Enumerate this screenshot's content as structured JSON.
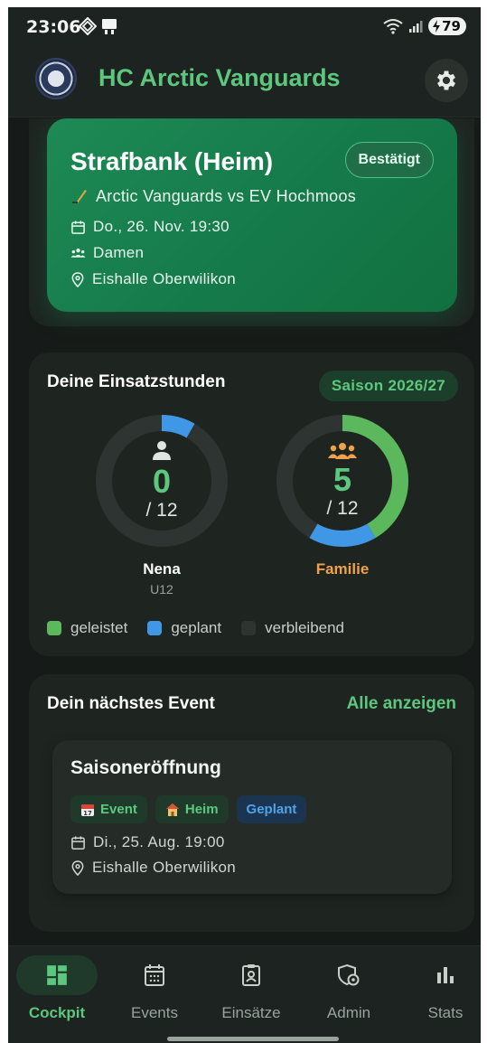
{
  "status_bar": {
    "time": "23:06",
    "battery": "79",
    "icons": [
      "nfc-icon",
      "cast-icon",
      "wifi-icon",
      "signal-icon",
      "battery-charging-icon"
    ]
  },
  "app": {
    "title": "HC Arctic Vanguards",
    "settings_icon": "gear-icon"
  },
  "duty_card": {
    "title": "Strafbank (Heim)",
    "status": "Bestätigt",
    "match": "Arctic Vanguards vs EV Hochmoos",
    "date": "Do., 26. Nov.  19:30",
    "team": "Damen",
    "location": "Eishalle Oberwilikon"
  },
  "hours": {
    "title": "Deine Einsatzstunden",
    "season": "Saison 2026/27",
    "persons": [
      {
        "name": "Nena",
        "sub": "U12",
        "done": 0,
        "planned": 1,
        "total": 12,
        "total_label": "/ 12",
        "value_label": "0",
        "name_color": "#ffffff",
        "icon_color": "#dfe5e1"
      },
      {
        "name": "Familie",
        "sub": "",
        "done": 5,
        "planned": 2,
        "total": 12,
        "total_label": "/ 12",
        "value_label": "5",
        "name_color": "#f0a24a",
        "icon_color": "#f0a24a"
      }
    ],
    "legend": [
      {
        "label": "geleistet",
        "color": "#5cb85c"
      },
      {
        "label": "geplant",
        "color": "#3f97e6"
      },
      {
        "label": "verbleibend",
        "color": "#2e3431"
      }
    ]
  },
  "next_event": {
    "title": "Dein nächstes Event",
    "show_all": "Alle anzeigen",
    "event": {
      "name": "Saisoneröffnung",
      "chips": [
        "Event",
        "Heim",
        "Geplant"
      ],
      "date": "Di., 25. Aug.  19:00",
      "location": "Eishalle Oberwilikon"
    }
  },
  "nav": [
    {
      "label": "Cockpit",
      "icon": "dashboard-icon",
      "active": true
    },
    {
      "label": "Events",
      "icon": "calendar-icon",
      "active": false
    },
    {
      "label": "Einsätze",
      "icon": "clipboard-user-icon",
      "active": false
    },
    {
      "label": "Admin",
      "icon": "shield-gear-icon",
      "active": false
    },
    {
      "label": "Stats",
      "icon": "bar-chart-icon",
      "active": false
    }
  ],
  "colors": {
    "accent": "#5ec77e",
    "done": "#5cb85c",
    "planned": "#3f97e6",
    "remaining": "#2e3431",
    "family": "#f0a24a"
  }
}
